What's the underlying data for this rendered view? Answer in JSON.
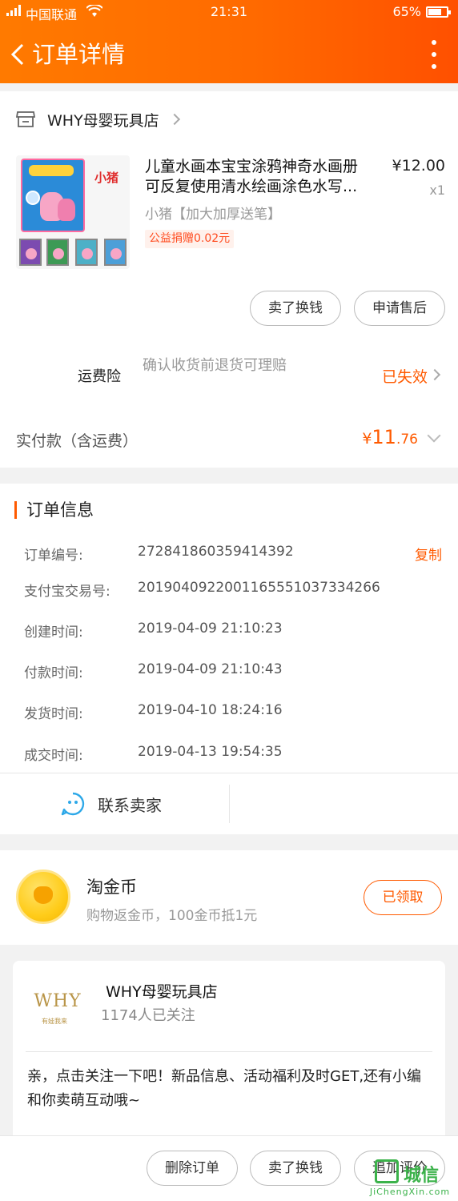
{
  "status_bar": {
    "carrier": "中国联通",
    "time": "21:31",
    "battery": "65%"
  },
  "header": {
    "title": "订单详情",
    "back_icon": "chevron-left-icon",
    "more_icon": "more-vertical-icon"
  },
  "shop": {
    "name": "WHY母婴玩具店",
    "icon": "store-icon"
  },
  "item": {
    "title_line1": "儿童水画本宝宝涂鸦神奇水画册",
    "title_line2": "可反复使用清水绘画涂色水写...",
    "price": "¥12.00",
    "qty": "x1",
    "sku": "小猪【加大加厚送笔】",
    "charity": "公益捐赠0.02元",
    "thumb_tag": "小猪"
  },
  "item_actions": {
    "sell": "卖了换钱",
    "after_sales": "申请售后"
  },
  "insurance": {
    "label": "运费险",
    "desc": "确认收货前退货可理赔",
    "status": "已失效"
  },
  "payment": {
    "label": "实付款（含运费）",
    "currency": "¥",
    "amount_int": "11",
    "amount_dec": ".76"
  },
  "order_info": {
    "title": "订单信息",
    "rows": [
      {
        "label": "订单编号:",
        "value": "272841860359414392"
      },
      {
        "label": "支付宝交易号:",
        "value": "2019040922001165551037334266"
      },
      {
        "label": "创建时间:",
        "value": "2019-04-09 21:10:23"
      },
      {
        "label": "付款时间:",
        "value": "2019-04-09 21:10:43"
      },
      {
        "label": "发货时间:",
        "value": "2019-04-10 18:24:16"
      },
      {
        "label": "成交时间:",
        "value": "2019-04-13 19:54:35"
      }
    ],
    "copy": "复制"
  },
  "contact": {
    "label": "联系卖家",
    "icon": "chat-face-icon"
  },
  "coins": {
    "title": "淘金币",
    "sub": "购物返金币，100金币抵1元",
    "button": "已领取"
  },
  "follow": {
    "logo_text": "WHY",
    "logo_sub": "有娃我来",
    "name": "WHY母婴玩具店",
    "fans": "1174人已关注",
    "message": "亲，点击关注一下吧！新品信息、活动福利及时GET,还有小编和你卖萌互动哦~"
  },
  "bottom_actions": {
    "delete": "删除订单",
    "sell": "卖了换钱",
    "review": "追加评价"
  },
  "watermark": {
    "cn": "城信",
    "en": "JiChengXin.com"
  },
  "colors": {
    "accent": "#ff5a00",
    "header_start": "#ff7a00",
    "header_end": "#ff5000",
    "watermark": "#3bb24a"
  }
}
